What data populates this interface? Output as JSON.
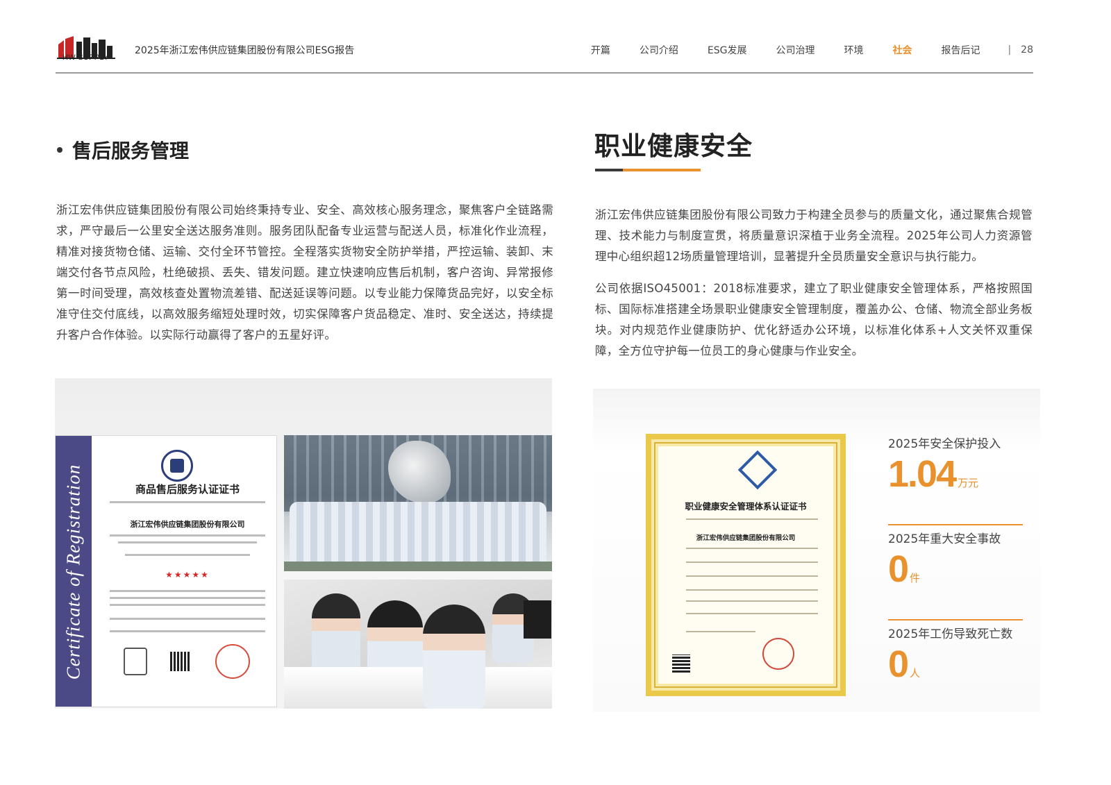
{
  "header": {
    "logo_text": "HW SUPPLY",
    "report_title": "2025年浙江宏伟供应链集团股份有限公司ESG报告",
    "nav": [
      "开篇",
      "公司介绍",
      "ESG发展",
      "公司治理",
      "环境",
      "社会",
      "报告后记"
    ],
    "active_nav": "社会",
    "separator": "|",
    "page_number": "28",
    "accent_color": "#e8912d"
  },
  "left": {
    "section_title": "售后服务管理",
    "paragraph": "浙江宏伟供应链集团股份有限公司始终秉持专业、安全、高效核心服务理念，聚焦客户全链路需求，严守最后一公里安全送达服务准则。服务团队配备专业运营与配送人员，标准化作业流程，精准对接货物仓储、运输、交付全环节管控。全程落实货物安全防护举措，严控运输、装卸、末端交付各节点风险，杜绝破损、丢失、错发问题。建立快速响应售后机制，客户咨询、异常报修第一时间受理，高效核查处置物流差错、配送延误等问题。以专业能力保障货品完好，以安全标准守住交付底线，以高效服务缩短处理时效，切实保障客户货品稳定、准时、安全送达，持续提升客户合作体验。以实际行动赢得了客户的五星好评。",
    "certificate": {
      "band_text": "Certificate of Registration",
      "title": "商品售后服务认证证书",
      "company": "浙江宏伟供应链集团股份有限公司",
      "stars": "★★★★★"
    }
  },
  "right": {
    "section_title": "职业健康安全",
    "paragraphs": [
      "浙江宏伟供应链集团股份有限公司致力于构建全员参与的质量文化，通过聚焦合规管理、技术能力与制度宣贯，将质量意识深植于业务全流程。2025年公司人力资源管理中心组织超12场质量管理培训，显著提升全员质量安全意识与执行能力。",
      "公司依据ISO45001：2018标准要求，建立了职业健康安全管理体系，严格按照国标、国际标准搭建全场景职业健康安全管理制度，覆盖办公、仓储、物流全部业务板块。对内规范作业健康防护、优化舒适办公环境，以标准化体系+人文关怀双重保障，全方位守护每一位员工的身心健康与作业安全。"
    ],
    "certificate": {
      "title": "职业健康安全管理体系认证证书",
      "company": "浙江宏伟供应链集团股份有限公司"
    },
    "stats": [
      {
        "label": "2025年安全保护投入",
        "value": "1.04",
        "unit": "万元"
      },
      {
        "label": "2025年重大安全事故",
        "value": "0",
        "unit": "件"
      },
      {
        "label": "2025年工伤导致死亡数",
        "value": "0",
        "unit": "人"
      }
    ]
  }
}
